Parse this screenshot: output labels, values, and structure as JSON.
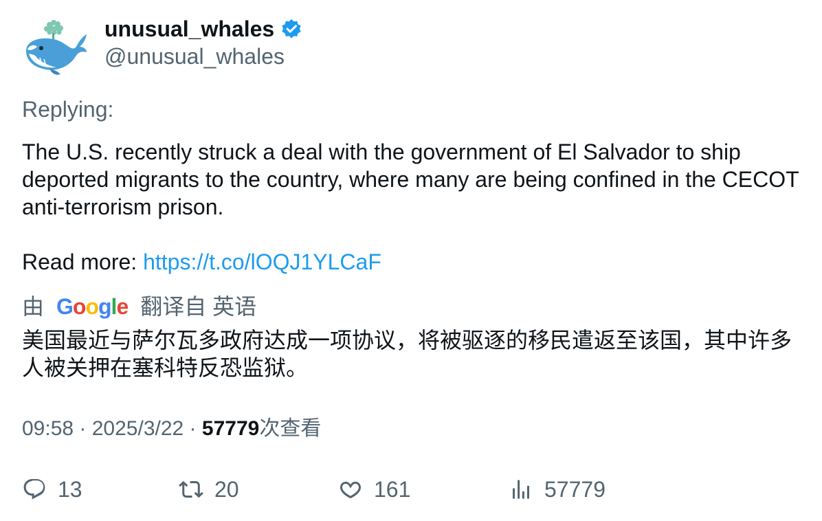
{
  "author": {
    "display_name": "unusual_whales",
    "handle": "@unusual_whales",
    "verified": true,
    "avatar_icon": "whale-avatar-icon"
  },
  "replying_label": "Replying:",
  "tweet": {
    "line1": "The U.S. recently struck a deal with the government of El Salvador to ship deported migrants to the country, where many are being confined in the CECOT anti-terrorism prison.",
    "read_more_label": "Read more: ",
    "link": "https://t.co/lOQJ1YLCaF"
  },
  "translation": {
    "by_label": "由",
    "provider": "Google",
    "from_label": "翻译自 英语",
    "text": "美国最近与萨尔瓦多政府达成一项协议，将被驱逐的移民遣返至该国，其中许多人被关押在塞科特反恐监狱。"
  },
  "meta": {
    "time": "09:58",
    "sep1": " · ",
    "date": "2025/3/22",
    "sep2": " · ",
    "views": "57779",
    "views_label": "次查看"
  },
  "actions": {
    "replies": "13",
    "retweets": "20",
    "likes": "161",
    "views": "57779"
  },
  "colors": {
    "text": "#0f1419",
    "secondary": "#536471",
    "link": "#1d9bf0",
    "verified": "#1d9bf0"
  }
}
